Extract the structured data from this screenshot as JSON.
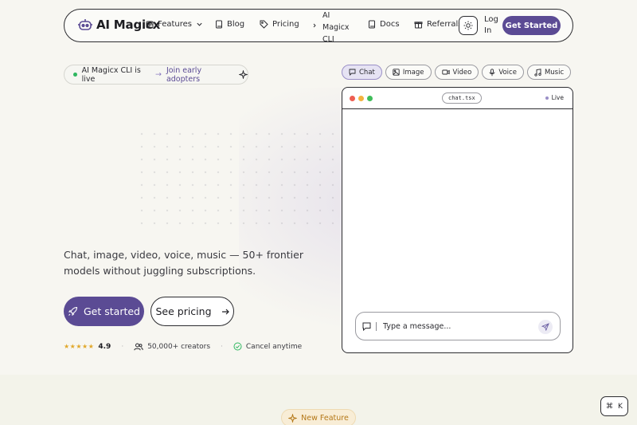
{
  "nav": {
    "brand": "AI Magicx",
    "features": "Features",
    "blog": "Blog",
    "pricing": "Pricing",
    "cli_line1": "AI",
    "cli_line2": "Magicx",
    "cli_line3": "CLI",
    "docs": "Docs",
    "referrals": "Referrals",
    "login_line1": "Log",
    "login_line2": "In",
    "get_started": "Get Started"
  },
  "announcement": {
    "text": "AI Magicx CLI is live",
    "arrow": "→",
    "link": "Join early adopters"
  },
  "hero": {
    "subtitle": "Chat, image, video, voice, music — 50+ frontier models without juggling subscriptions.",
    "cta_primary": "Get started",
    "cta_secondary": "See pricing",
    "stars": "★★★★★",
    "rating": "4.9",
    "creators": "50,000+ creators",
    "cancel": "Cancel anytime",
    "separator": "·"
  },
  "demo": {
    "tabs": [
      "Chat",
      "Image",
      "Video",
      "Voice",
      "Music"
    ],
    "active_tab": "Chat",
    "file": "chat.tsx",
    "live": "Live",
    "placeholder": "Type a message..."
  },
  "footer": {
    "new_feature": "New Feature",
    "kbd_cmd": "⌘",
    "kbd_key": "K"
  },
  "colors": {
    "primary": "#5b4b94",
    "star": "#e1a82b",
    "live_green": "#2fb760",
    "badge_orange": "#b47818"
  }
}
